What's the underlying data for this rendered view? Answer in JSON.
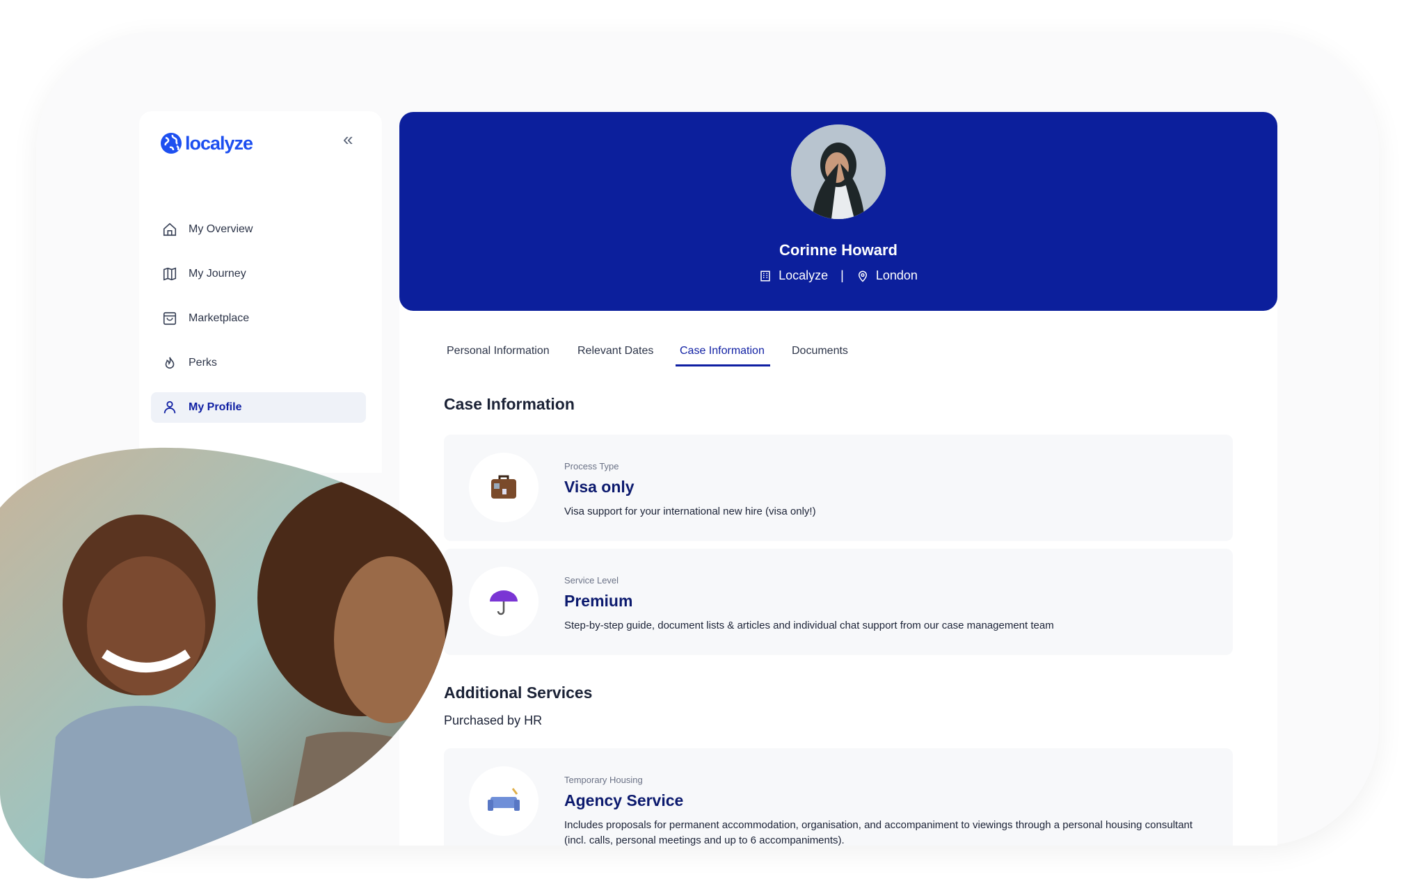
{
  "brand": {
    "logo_text": "localyze",
    "accent": "#0c1f9c",
    "logo_color": "#1d4ff0"
  },
  "sidebar": {
    "collapse_icon": "chevrons-left-icon",
    "items": [
      {
        "label": "My Overview",
        "icon": "home-icon"
      },
      {
        "label": "My Journey",
        "icon": "map-icon"
      },
      {
        "label": "Marketplace",
        "icon": "shopping-bag-icon"
      },
      {
        "label": "Perks",
        "icon": "flame-icon"
      },
      {
        "label": "My Profile",
        "icon": "user-icon",
        "active": true
      }
    ]
  },
  "profile": {
    "name": "Corinne Howard",
    "company": "Localyze",
    "separator": "|",
    "location": "London"
  },
  "tabs": [
    {
      "label": "Personal Information"
    },
    {
      "label": "Relevant Dates"
    },
    {
      "label": "Case Information",
      "active": true
    },
    {
      "label": "Documents"
    }
  ],
  "case_info": {
    "heading": "Case Information",
    "items": [
      {
        "label": "Process Type",
        "title": "Visa only",
        "description": "Visa support for your international new hire (visa only!)",
        "icon": "suitcase-icon"
      },
      {
        "label": "Service Level",
        "title": "Premium",
        "description": "Step-by-step guide, document lists & articles and individual chat support from our case management team",
        "icon": "umbrella-icon"
      }
    ]
  },
  "additional": {
    "heading": "Additional Services",
    "subheading": "Purchased by HR",
    "items": [
      {
        "label": "Temporary Housing",
        "title": "Agency Service",
        "description": "Includes proposals for permanent accommodation, organisation, and accompaniment to viewings through a personal housing consultant (incl. calls, personal meetings and up to 6 accompaniments).",
        "icon": "sofa-icon"
      }
    ]
  }
}
